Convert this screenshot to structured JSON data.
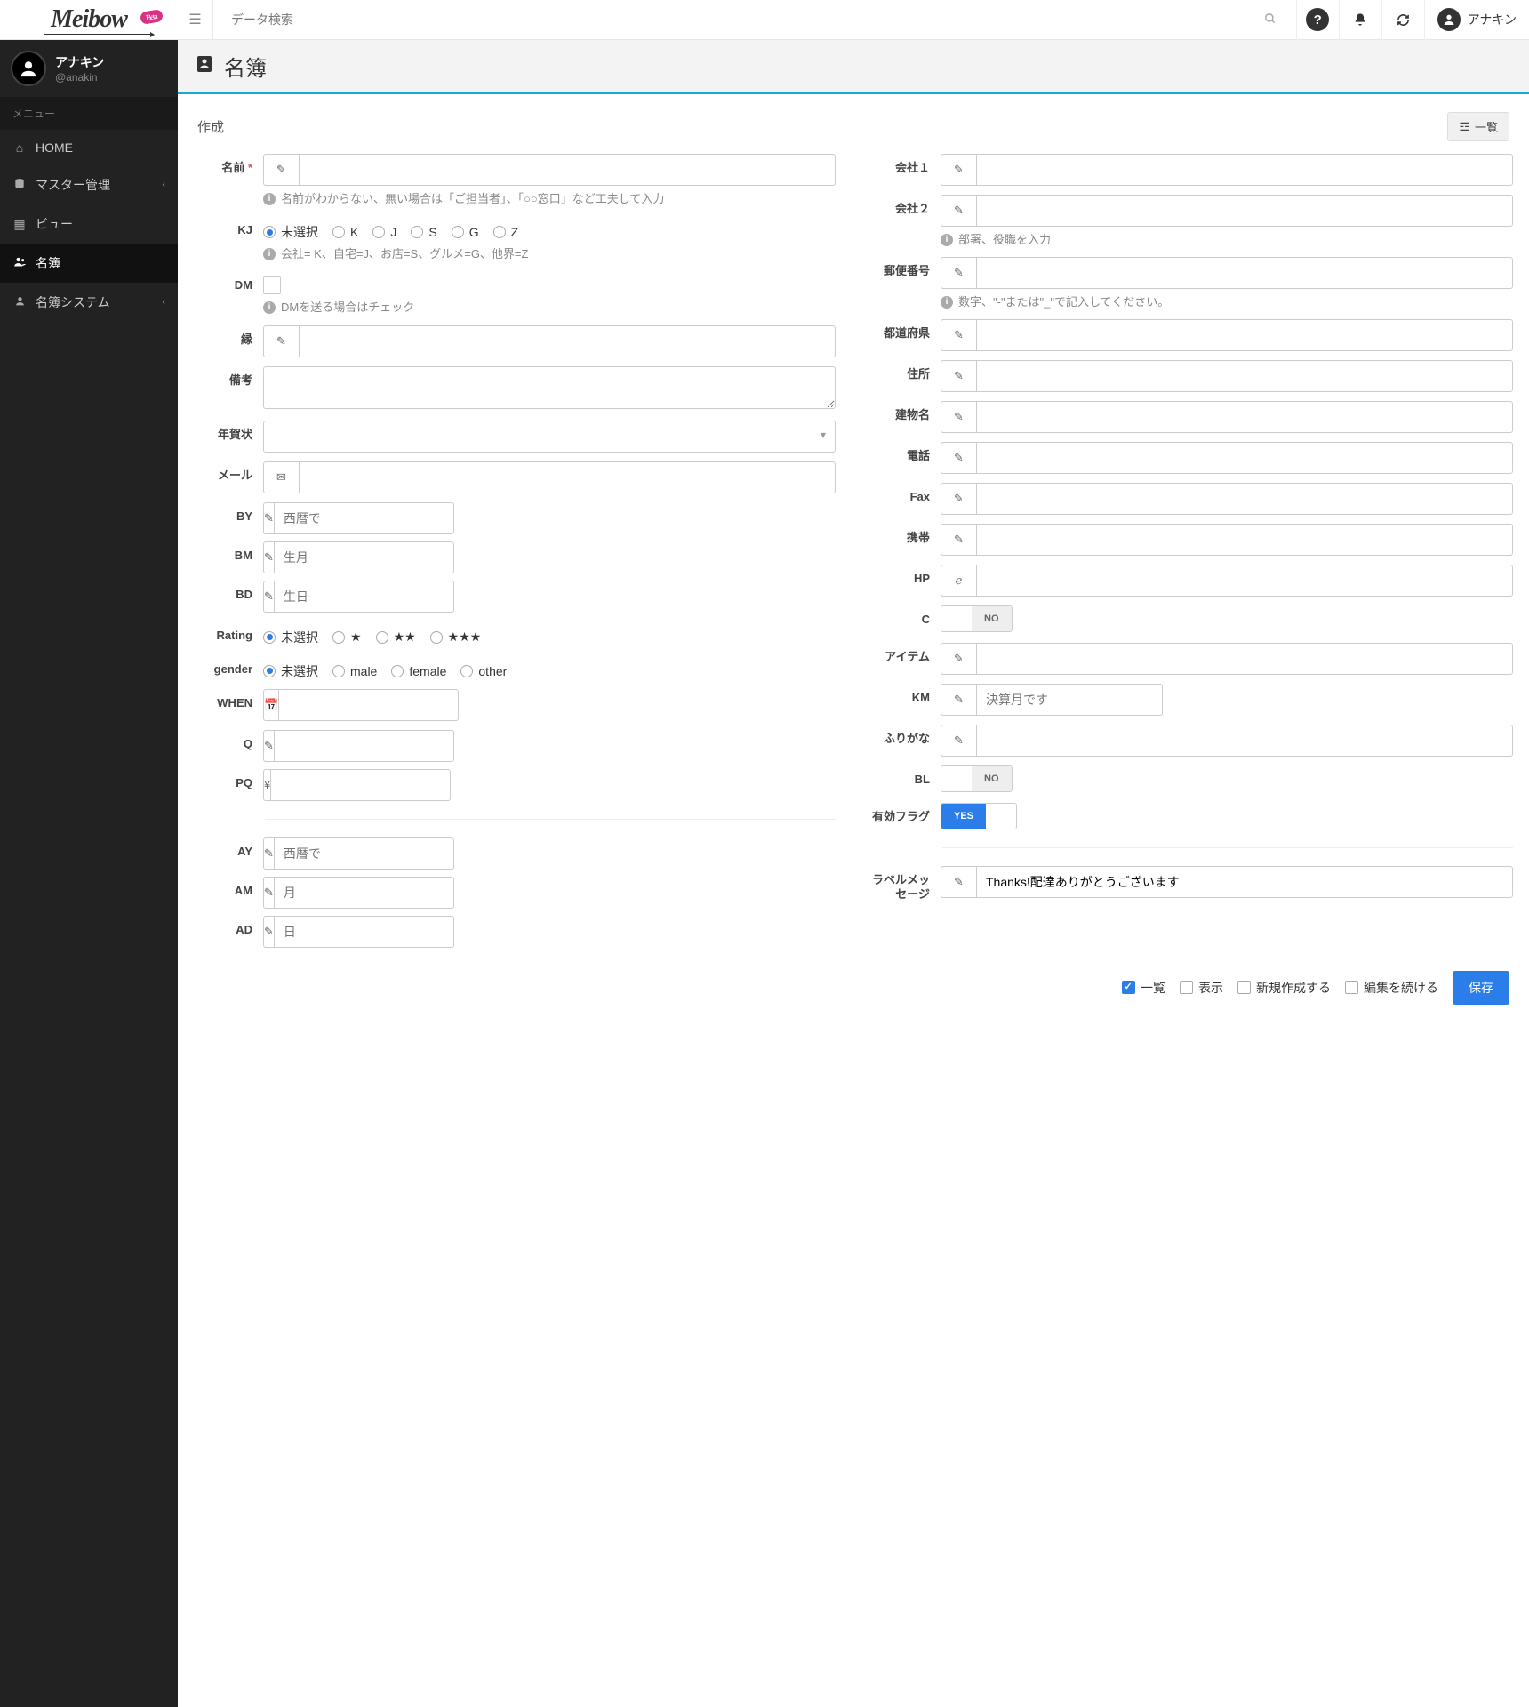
{
  "app": {
    "name": "Meibow",
    "beta": "Beta"
  },
  "search": {
    "placeholder": "データ検索"
  },
  "user": {
    "name": "アナキン",
    "handle": "@anakin"
  },
  "sidebar": {
    "menu_header": "メニュー",
    "items": [
      {
        "label": "HOME"
      },
      {
        "label": "マスター管理",
        "chev": true
      },
      {
        "label": "ビュー"
      },
      {
        "label": "名簿",
        "active": true
      },
      {
        "label": "名簿システム",
        "chev": true
      }
    ]
  },
  "page": {
    "title": "名簿",
    "subtitle": "作成",
    "list_btn": "一覧"
  },
  "left": {
    "name": {
      "label": "名前",
      "hint": "名前がわからない、無い場合は「ご担当者」、「○○窓口」など工夫して入力"
    },
    "kj": {
      "label": "KJ",
      "options": [
        "未選択",
        "K",
        "J",
        "S",
        "G",
        "Z"
      ],
      "selected": 0,
      "hint": "会社= K、自宅=J、お店=S、グルメ=G、他界=Z"
    },
    "dm": {
      "label": "DM",
      "hint": "DMを送る場合はチェック"
    },
    "en": {
      "label": "縁"
    },
    "biko": {
      "label": "備考"
    },
    "nenga": {
      "label": "年賀状"
    },
    "mail": {
      "label": "メール"
    },
    "by": {
      "label": "BY",
      "ph": "西暦で"
    },
    "bm": {
      "label": "BM",
      "ph": "生月"
    },
    "bd": {
      "label": "BD",
      "ph": "生日"
    },
    "rating": {
      "label": "Rating",
      "options": [
        "未選択",
        "★",
        "★★",
        "★★★"
      ],
      "selected": 0
    },
    "gender": {
      "label": "gender",
      "options": [
        "未選択",
        "male",
        "female",
        "other"
      ],
      "selected": 0
    },
    "when": {
      "label": "WHEN"
    },
    "q": {
      "label": "Q"
    },
    "pq": {
      "label": "PQ",
      "addon": "¥"
    },
    "ay": {
      "label": "AY",
      "ph": "西暦で"
    },
    "am": {
      "label": "AM",
      "ph": "月"
    },
    "ad": {
      "label": "AD",
      "ph": "日"
    }
  },
  "right": {
    "company1": {
      "label": "会社１"
    },
    "company2": {
      "label": "会社２",
      "hint": "部署、役職を入力"
    },
    "zip": {
      "label": "郵便番号",
      "hint": "数字、\"-\"または\"_\"で記入してください。"
    },
    "pref": {
      "label": "都道府県"
    },
    "addr": {
      "label": "住所"
    },
    "bldg": {
      "label": "建物名"
    },
    "tel": {
      "label": "電話"
    },
    "fax": {
      "label": "Fax"
    },
    "mobile": {
      "label": "携帯"
    },
    "hp": {
      "label": "HP"
    },
    "c": {
      "label": "C",
      "state": "NO"
    },
    "item": {
      "label": "アイテム"
    },
    "km": {
      "label": "KM",
      "ph": "決算月です"
    },
    "furigana": {
      "label": "ふりがな"
    },
    "bl": {
      "label": "BL",
      "state": "NO"
    },
    "active": {
      "label": "有効フラグ",
      "state": "YES"
    },
    "labelmsg": {
      "label": "ラベルメッセージ",
      "value": "Thanks!配達ありがとうございます"
    }
  },
  "footer": {
    "opts": [
      {
        "label": "一覧",
        "checked": true
      },
      {
        "label": "表示",
        "checked": false
      },
      {
        "label": "新規作成する",
        "checked": false
      },
      {
        "label": "編集を続ける",
        "checked": false
      }
    ],
    "save": "保存"
  }
}
